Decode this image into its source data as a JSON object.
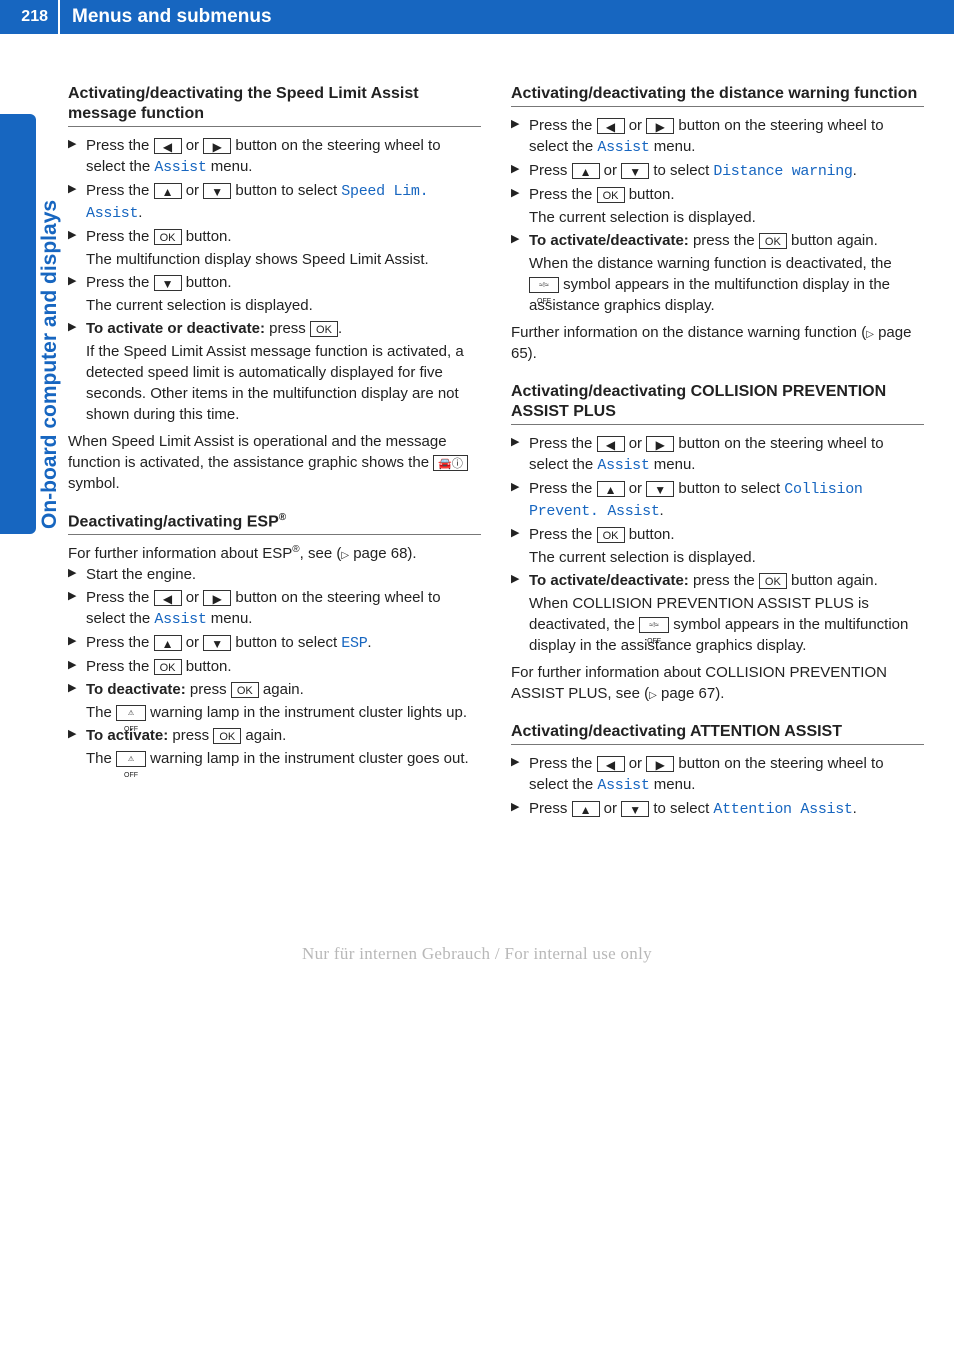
{
  "page_number": "218",
  "header_title": "Menus and submenus",
  "side_tab": "On-board computer and displays",
  "footer": "Nur für internen Gebrauch / For internal use only",
  "buttons": {
    "left": "◀",
    "right": "▶",
    "up": "▲",
    "down": "▼",
    "ok": "OK"
  },
  "menu": {
    "assist": "Assist",
    "speed_lim": "Speed Lim. Assist",
    "esp": "ESP",
    "distance_warning": "Distance warning",
    "collision": "Collision Prevent. Assist",
    "attention": "Attention Assist"
  },
  "icons": {
    "car_sign": "🚗",
    "esp_off": "OFF",
    "dist_off": "OFF"
  },
  "left_col": {
    "h1": "Activating/deactivating the Speed Limit Assist message function",
    "s1a": "Press the ",
    "s1b": " or ",
    "s1c": " button on the steering wheel to select the ",
    "s1d": " menu.",
    "s2a": "Press the ",
    "s2b": " or ",
    "s2c": " button to select ",
    "s2d": ".",
    "s3a": "Press the ",
    "s3b": " button.",
    "s3c": "The multifunction display shows Speed Limit Assist.",
    "s4a": "Press the ",
    "s4b": " button.",
    "s4c": "The current selection is displayed.",
    "s5a": "To activate or deactivate:",
    "s5b": " press ",
    "s5c": ".",
    "s5d": "If the Speed Limit Assist message function is activated, a detected speed limit is automatically displayed for five seconds. Other items in the multifunction display are not shown during this time.",
    "p1a": "When Speed Limit Assist is operational and the message function is activated, the assistance graphic shows the ",
    "p1b": " symbol.",
    "h2a": "Deactivating/activating ESP",
    "h2b": "®",
    "p2a": "For further information about ESP",
    "p2b": "®",
    "p2c": ", see (",
    "p2d": " page 68).",
    "s6": "Start the engine.",
    "s7a": "Press the ",
    "s7b": " or ",
    "s7c": " button on the steering wheel to select the ",
    "s7d": " menu.",
    "s8a": "Press the ",
    "s8b": " or ",
    "s8c": " button to select ",
    "s8d": ".",
    "s9a": "Press the ",
    "s9b": " button.",
    "s10a": "To deactivate:",
    "s10b": " press ",
    "s10c": " again.",
    "s10d": "The ",
    "s10e": " warning lamp in the instrument cluster lights up.",
    "s11a": "To activate:",
    "s11b": " press ",
    "s11c": " again.",
    "s11d": "The ",
    "s11e": " warning lamp in the instrument cluster goes out."
  },
  "right_col": {
    "h1": "Activating/deactivating the distance warning function",
    "s1a": "Press the ",
    "s1b": " or ",
    "s1c": " button on the steering wheel to select the ",
    "s1d": " menu.",
    "s2a": "Press ",
    "s2b": " or ",
    "s2c": " to select ",
    "s2d": ".",
    "s3a": "Press the ",
    "s3b": " button.",
    "s3c": "The current selection is displayed.",
    "s4a": "To activate/deactivate:",
    "s4b": " press the ",
    "s4c": " button again.",
    "s4d": "When the distance warning function is deactivated, the ",
    "s4e": " symbol appears in the multifunction display in the assistance graphics display.",
    "p1a": "Further information on the distance warning function (",
    "p1b": " page 65).",
    "h2": "Activating/deactivating COLLISION PREVENTION ASSIST PLUS",
    "s5a": "Press the ",
    "s5b": " or ",
    "s5c": " button on the steering wheel to select the ",
    "s5d": " menu.",
    "s6a": "Press the ",
    "s6b": " or ",
    "s6c": " button to select ",
    "s6d": ".",
    "s7a": "Press the ",
    "s7b": " button.",
    "s7c": "The current selection is displayed.",
    "s8a": "To activate/deactivate:",
    "s8b": " press the ",
    "s8c": " button again.",
    "s8d": "When COLLISION PREVENTION ASSIST PLUS is deactivated, the ",
    "s8e": " symbol appears in the multifunction display in the assistance graphics display.",
    "p2a": "For further information about COLLISION PREVENTION ASSIST PLUS, see (",
    "p2b": " page 67).",
    "h3": "Activating/deactivating ATTENTION ASSIST",
    "s9a": "Press the ",
    "s9b": " or ",
    "s9c": " button on the steering wheel to select the ",
    "s9d": " menu.",
    "s10a": "Press ",
    "s10b": " or ",
    "s10c": " to select ",
    "s10d": "."
  }
}
